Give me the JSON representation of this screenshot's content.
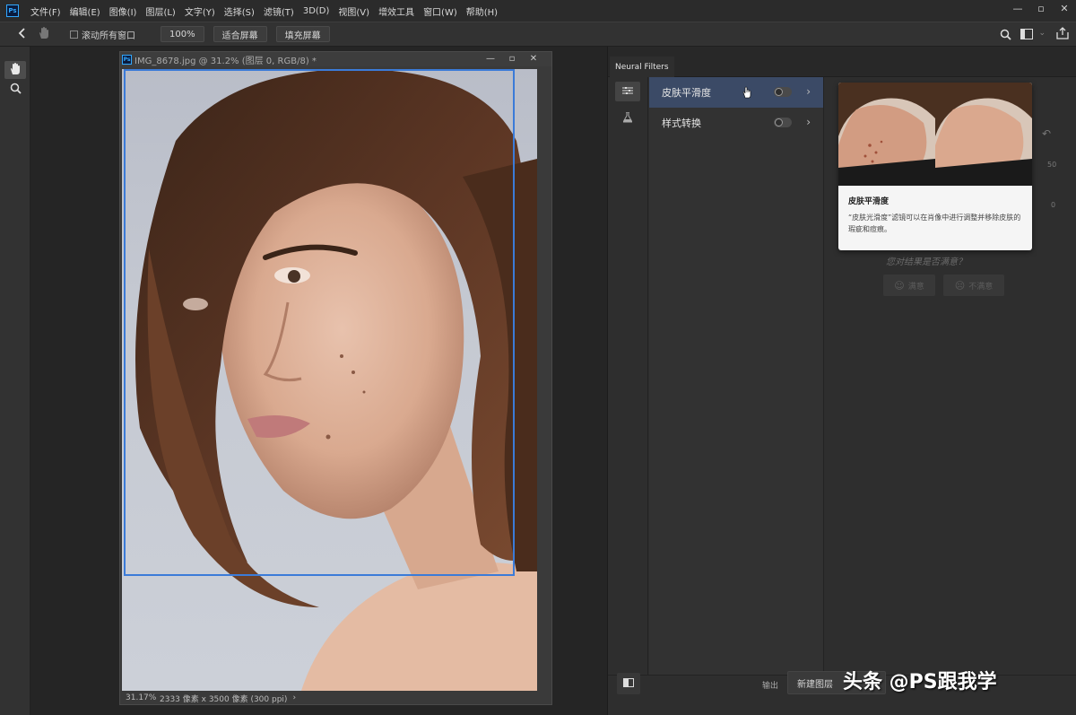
{
  "app": {
    "logo": "Ps",
    "menu": [
      "文件(F)",
      "编辑(E)",
      "图像(I)",
      "图层(L)",
      "文字(Y)",
      "选择(S)",
      "滤镜(T)",
      "3D(D)",
      "视图(V)",
      "增效工具",
      "窗口(W)",
      "帮助(H)"
    ],
    "window_controls": [
      "—",
      "▫",
      "✕"
    ]
  },
  "options_bar": {
    "scroll_all_label": "滚动所有窗口",
    "zoom_label": "100%",
    "fit_screen_label": "适合屏幕",
    "fill_screen_label": "填充屏幕"
  },
  "document": {
    "tab_title": "IMG_8678.jpg @ 31.2% (图层 0, RGB/8) *",
    "zoom": "31.17%",
    "info": "2333 像素 x 3500 像素 (300 ppi)"
  },
  "panel": {
    "tab_label": "Neural Filters",
    "filters": [
      {
        "label": "皮肤平滑度",
        "active": true
      },
      {
        "label": "样式转换",
        "active": false
      }
    ],
    "tooltip": {
      "title": "皮肤平滑度",
      "description": "“皮肤光滑度”滤镜可以在肖像中进行调整并移除皮肤的瑕疵和痘痕。"
    },
    "side_values": [
      "50",
      "0"
    ],
    "feedback": {
      "question": "您对结果是否满意？",
      "yes": "满意",
      "no": "不满意"
    },
    "output": {
      "label": "输出",
      "value": "新建图层"
    }
  },
  "watermark": "头条 @PS跟我学",
  "colors": {
    "accent": "#3b7bd8",
    "active_row": "#3b4a66",
    "bg": "#252525",
    "ps_blue": "#31a8ff"
  }
}
